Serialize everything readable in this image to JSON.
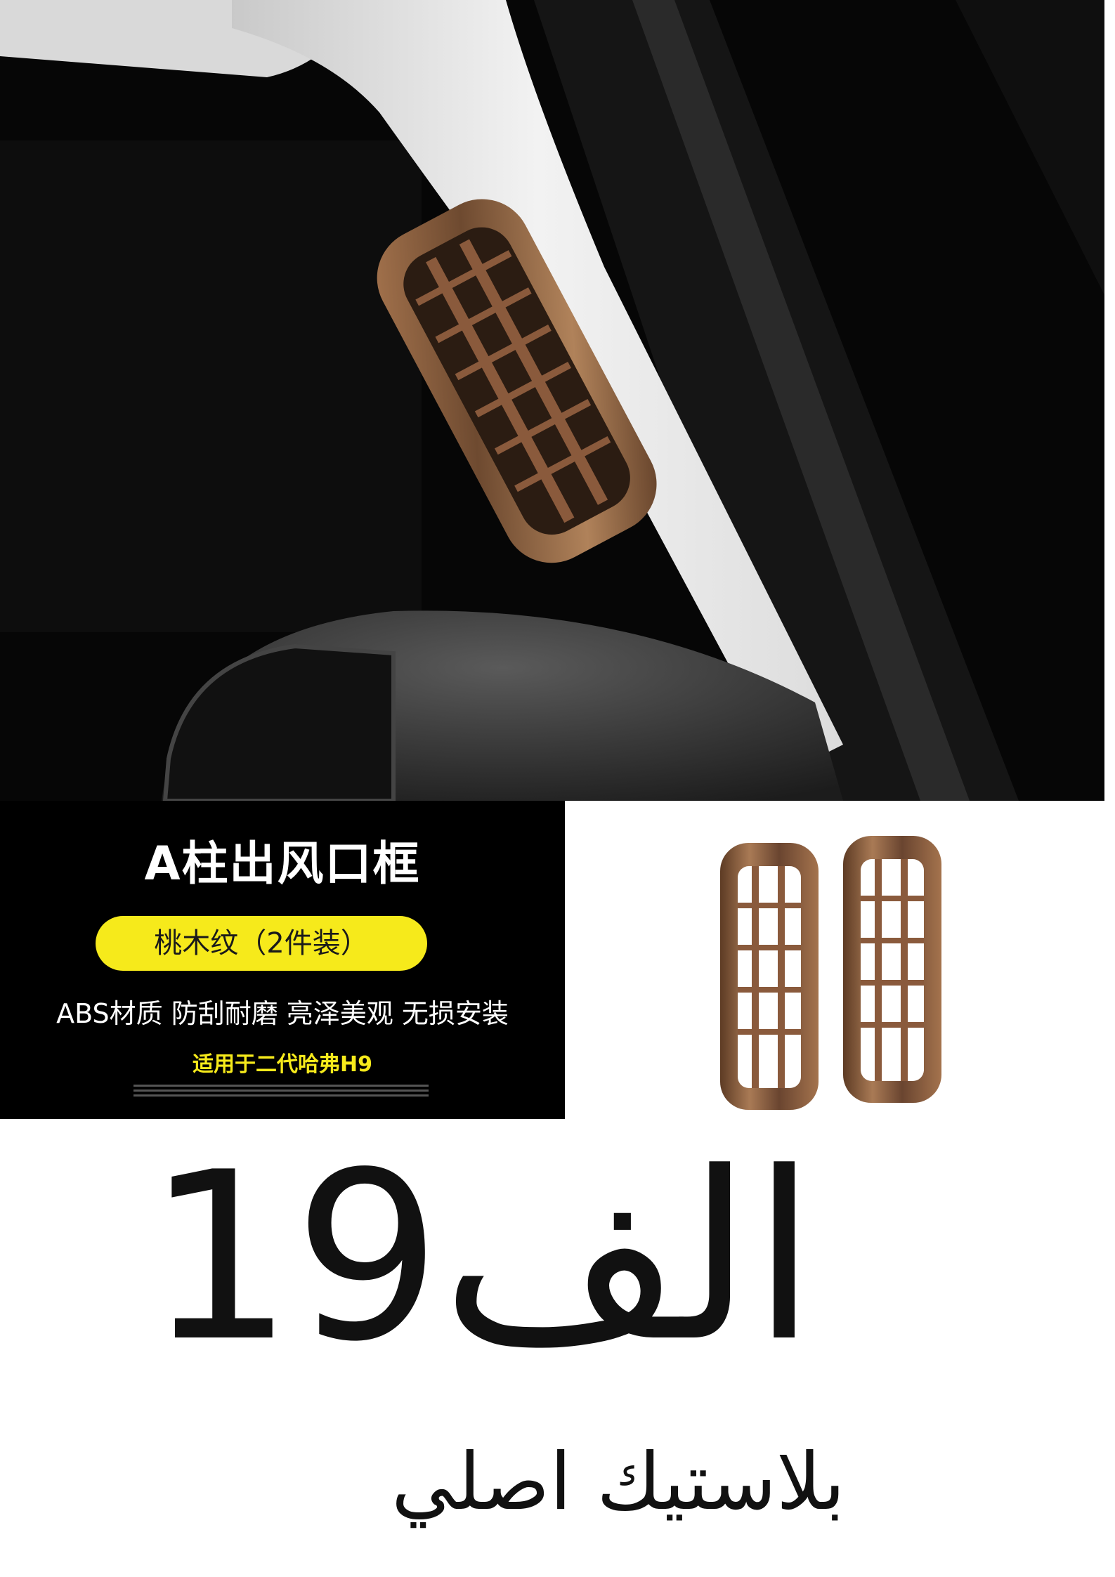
{
  "hero": {
    "description_icon": "car-a-pillar-air-vent-photo"
  },
  "promo": {
    "title": "A柱出风口框",
    "pill": "桃木纹（2件装）",
    "features": "ABS材质 防刮耐磨 亮泽美观 无损安装",
    "fit": "适用于二代哈弗H9"
  },
  "product": {
    "icon": "air-vent-frame-pair-icon",
    "color": "#8a5a3c"
  },
  "price": {
    "text": "19الف"
  },
  "subtitle": "بلاستيك اصلي",
  "colors": {
    "accent_yellow": "#f6ea1b",
    "wood": "#8a5a3c",
    "black": "#000000"
  }
}
